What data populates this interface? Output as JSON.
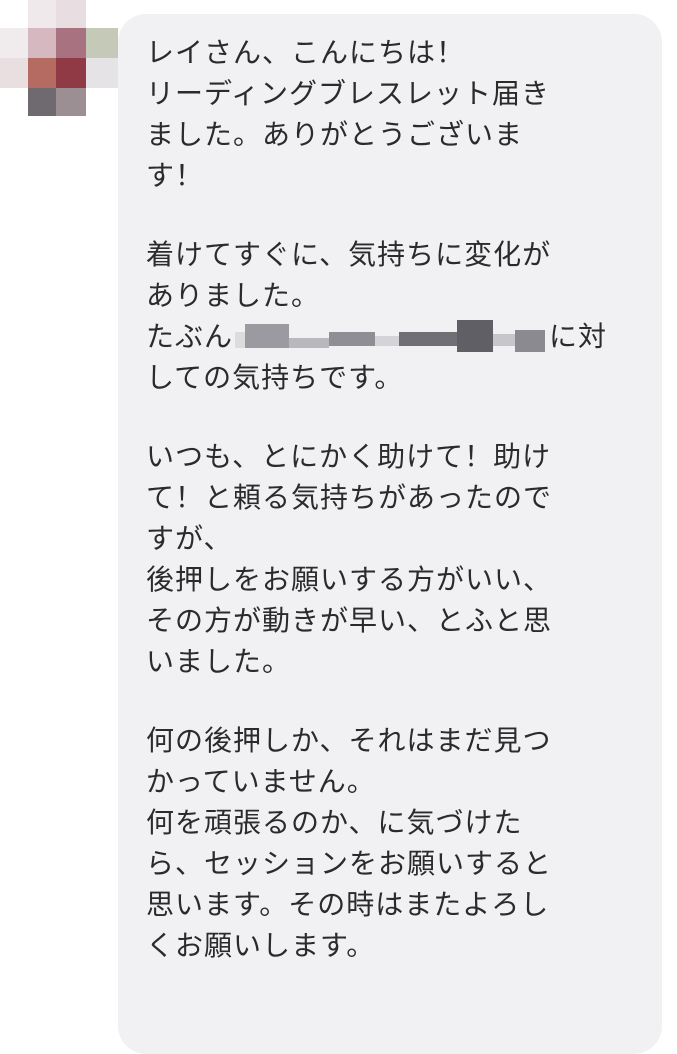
{
  "avatar": {
    "pixel_colors": [
      "#e8e2e4",
      "#d6b8c0",
      "#a06a78",
      "#c5c9b8",
      "#8f3a44",
      "#b56a62",
      "#e9dfe1",
      "#6f6a70",
      "#9b8f94"
    ]
  },
  "message": {
    "bubble_color": "#f1f1f3",
    "text_color": "#2b2b2b",
    "lines": [
      "レイさん、こんにちは！",
      "リーディングブレスレット届き",
      "ました。ありがとうございま",
      "す！",
      "",
      "着けてすぐに、気持ちに変化が",
      "ありました。",
      "たぶん",
      "しての気持ちです。",
      "",
      "いつも、とにかく助けて！助け",
      "て！と頼る気持ちがあったので",
      "すが、",
      "後押しをお願いする方がいい、",
      "その方が動きが早い、とふと思",
      "いました。",
      "",
      "何の後押しか、それはまだ見つ",
      "かっていません。",
      "何を頑張るのか、に気づけた",
      "ら、セッションをお願いすると",
      "思います。その時はまたよろし",
      "くお願いします。"
    ],
    "line_8_suffix": "に対"
  }
}
